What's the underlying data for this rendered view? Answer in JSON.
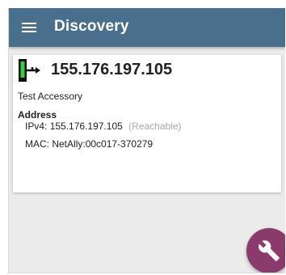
{
  "appbar": {
    "title": "Discovery",
    "menu_icon": "hamburger-menu-icon"
  },
  "device": {
    "icon": "network-device-icon",
    "title": "155.176.197.105",
    "type": "Test Accessory",
    "address_heading": "Address",
    "ipv4_label": "IPv4:",
    "ipv4_value": "155.176.197.105",
    "ipv4_status": "(Reachable)",
    "mac_label": "MAC:",
    "mac_value": "NetAlly:00c017-370279"
  },
  "fab": {
    "icon": "wrench-icon"
  },
  "colors": {
    "appbar": "#4a6f8c",
    "fab": "#8a3a6b",
    "device_icon": "#3ccb3c"
  }
}
